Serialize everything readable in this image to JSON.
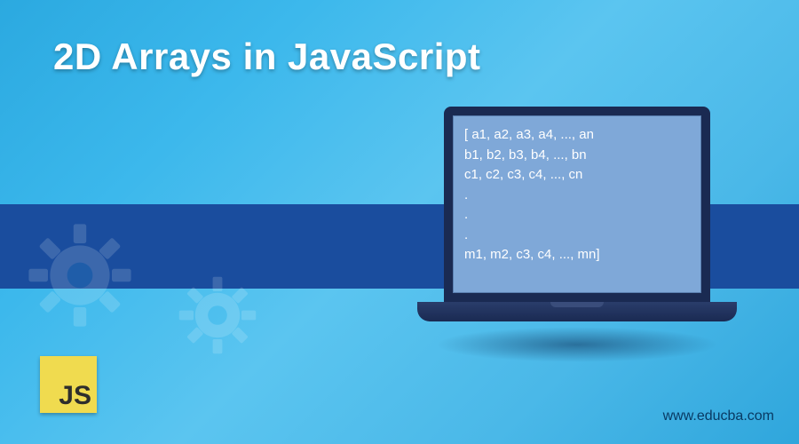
{
  "title": "2D Arrays in JavaScript",
  "website": "www.educba.com",
  "logo": {
    "text": "JS"
  },
  "laptop": {
    "lines": [
      "[ a1, a2, a3, a4, ..., an",
      "b1, b2, b3, b4, ..., bn",
      "c1, c2, c3, c4, ..., cn",
      ".",
      ".",
      ".",
      "m1, m2, c3, c4, ..., mn]"
    ]
  }
}
